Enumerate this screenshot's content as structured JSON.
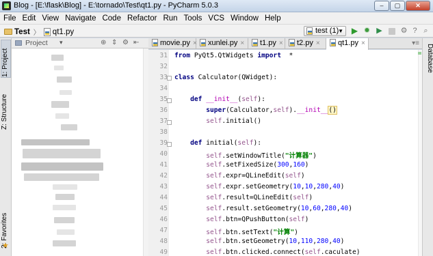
{
  "window": {
    "title": "Blog - [E:\\flask\\Blog] - E:\\tornado\\Test\\qt1.py - PyCharm 5.0.3",
    "controls": [
      "–",
      "▢",
      "✕"
    ]
  },
  "menu": [
    "File",
    "Edit",
    "View",
    "Navigate",
    "Code",
    "Refactor",
    "Run",
    "Tools",
    "VCS",
    "Window",
    "Help"
  ],
  "breadcrumb": {
    "folder": "Test",
    "file": "qt1.py"
  },
  "run_config": {
    "label": "test (1)"
  },
  "left_tabs": {
    "project": "1: Project",
    "structure": "Z: Structure",
    "favorites": "2: Favorites"
  },
  "right_tabs": {
    "database": "Database"
  },
  "project_panel": {
    "title": "Project"
  },
  "tabs": [
    {
      "label": "movie.py"
    },
    {
      "label": "xunlei.py"
    },
    {
      "label": "t1.py"
    },
    {
      "label": "t2.py"
    },
    {
      "label": "qt1.py"
    }
  ],
  "line_numbers": [
    "31",
    "32",
    "33",
    "34",
    "35",
    "36",
    "37",
    "38",
    "39",
    "40",
    "41",
    "42",
    "43",
    "44",
    "45",
    "46",
    "47",
    "48",
    "49"
  ]
}
